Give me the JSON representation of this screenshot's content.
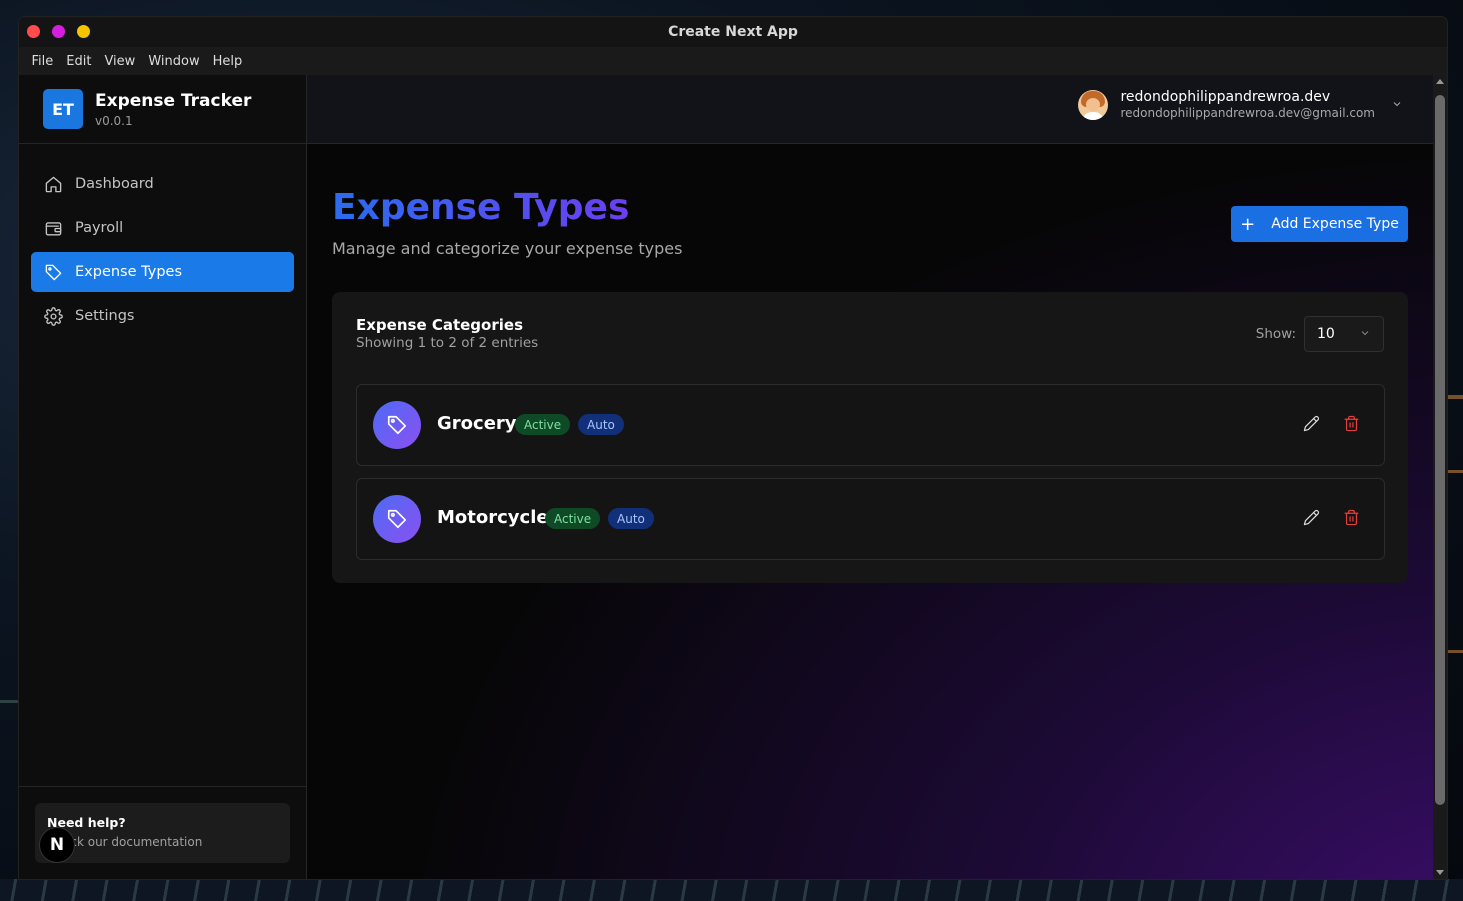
{
  "window": {
    "title": "Create Next App",
    "menu": [
      "File",
      "Edit",
      "View",
      "Window",
      "Help"
    ]
  },
  "brand": {
    "logo": "ET",
    "name": "Expense Tracker",
    "version": "v0.0.1"
  },
  "nav": {
    "items": [
      {
        "label": "Dashboard",
        "icon": "home-icon",
        "active": false
      },
      {
        "label": "Payroll",
        "icon": "wallet-icon",
        "active": false
      },
      {
        "label": "Expense Types",
        "icon": "tag-icon",
        "active": true
      },
      {
        "label": "Settings",
        "icon": "gear-icon",
        "active": false
      }
    ]
  },
  "help": {
    "title": "Need help?",
    "text": "Check our documentation",
    "badge": "N"
  },
  "user": {
    "name": "redondophilippandrewroa.dev",
    "email": "redondophilippandrewroa.dev@gmail.com"
  },
  "page": {
    "title": "Expense Types",
    "subtitle": "Manage and categorize your expense types",
    "add_button": "Add Expense Type"
  },
  "card": {
    "title": "Expense Categories",
    "subtitle": "Showing 1 to 2 of 2 entries",
    "show_label": "Show:",
    "show_value": "10",
    "rows": [
      {
        "name": "Grocery",
        "status": "Active",
        "mode": "Auto"
      },
      {
        "name": "Motorcycle",
        "status": "Active",
        "mode": "Auto"
      }
    ]
  },
  "colors": {
    "accent": "#1a7be8",
    "title_gradient_start": "#2a6cf0",
    "title_gradient_end": "#6b3ff0",
    "delete": "#e53e3e"
  }
}
